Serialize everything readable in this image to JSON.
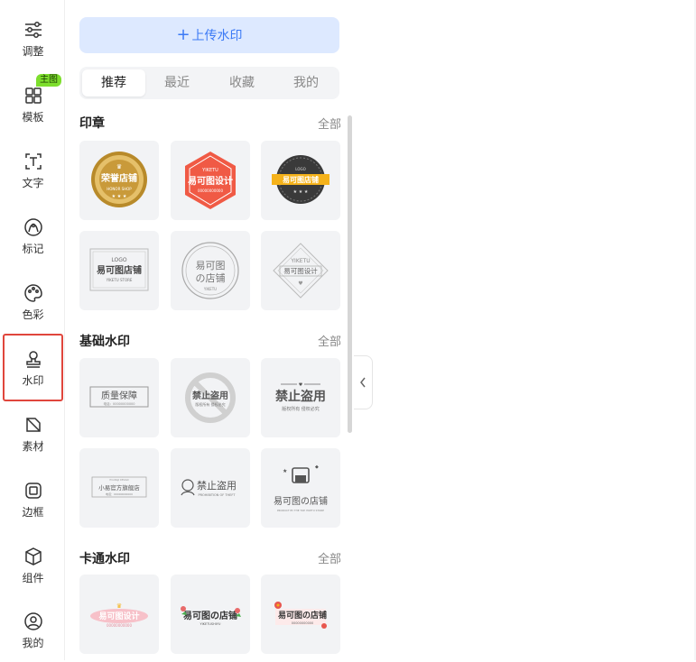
{
  "rail": {
    "items": [
      {
        "label": "调整",
        "icon": "sliders-icon"
      },
      {
        "label": "模板",
        "icon": "template-icon",
        "badge": "主图"
      },
      {
        "label": "文字",
        "icon": "text-icon"
      },
      {
        "label": "标记",
        "icon": "marker-icon"
      },
      {
        "label": "色彩",
        "icon": "palette-icon"
      },
      {
        "label": "水印",
        "icon": "stamp-icon",
        "active": true
      },
      {
        "label": "素材",
        "icon": "material-icon"
      },
      {
        "label": "边框",
        "icon": "border-icon"
      },
      {
        "label": "组件",
        "icon": "component-icon"
      },
      {
        "label": "我的",
        "icon": "user-icon"
      }
    ]
  },
  "panel": {
    "upload_label": "上传水印",
    "tabs": [
      "推荐",
      "最近",
      "收藏",
      "我的"
    ],
    "active_tab": "推荐",
    "sections": [
      {
        "title": "印章",
        "all_label": "全部",
        "cards": [
          {
            "text": "荣誉店铺",
            "sub": "HONOR SHOP"
          },
          {
            "text": "易可图设计",
            "top": "YIKETU",
            "sub": "00000000000"
          },
          {
            "text": "易可图店铺",
            "top": "LOGO"
          },
          {
            "text": "易可图店铺",
            "top": "LOGO",
            "sub": "YIKETU STORE"
          },
          {
            "text": "易可图",
            "text2": "の店铺",
            "sub": "YIKETU"
          },
          {
            "text": "易可图设计",
            "top": "YIKETU"
          }
        ]
      },
      {
        "title": "基础水印",
        "all_label": "全部",
        "cards": [
          {
            "text": "质量保障",
            "sub": "电话：00000000000"
          },
          {
            "text": "禁止盗用",
            "sub": "版权所有 侵权必究"
          },
          {
            "text": "禁止盗用",
            "sub": "版权所有  侵权必究"
          },
          {
            "text": "小易官方旗舰店",
            "top": "HUANGJI DESIGN",
            "sub": "电话：00000000000"
          },
          {
            "text": "禁止盗用",
            "sub": "PROHIBITION OF THEFT"
          },
          {
            "text": "易可图の店铺",
            "sub": "PRODUCT BY THE TOP YIKETU STORE"
          }
        ]
      },
      {
        "title": "卡通水印",
        "all_label": "全部",
        "cards": [
          {
            "text": "易可图设计",
            "sub": "00000000000"
          },
          {
            "text": "易可图の店铺",
            "sub": "YIKETUSHIYU"
          },
          {
            "text": "易可图の店铺",
            "sub": "00000000000"
          }
        ]
      }
    ]
  },
  "colors": {
    "accent": "#3c7af5",
    "active_border": "#e0463c",
    "badge": "#7dde2d"
  }
}
